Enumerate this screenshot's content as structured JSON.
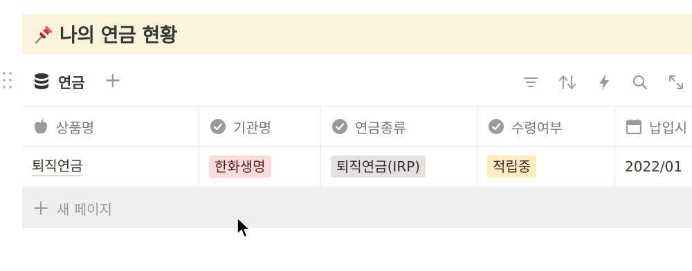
{
  "callout": {
    "emoji": "pushpin-icon",
    "title": "나의 연금 현황",
    "bg": "#fbf3db"
  },
  "database": {
    "title": "연금",
    "add_label": "+",
    "toolbar": [
      "filter-icon",
      "sort-icon",
      "automation-icon",
      "search-icon",
      "expand-icon"
    ]
  },
  "table": {
    "columns": [
      {
        "label": "상품명",
        "icon": "apple-icon"
      },
      {
        "label": "기관명",
        "icon": "check-circle-icon"
      },
      {
        "label": "연금종류",
        "icon": "check-circle-icon"
      },
      {
        "label": "수령여부",
        "icon": "check-circle-icon"
      },
      {
        "label": "납입시",
        "icon": "calendar-icon"
      }
    ],
    "rows": [
      {
        "product": "퇴직연금",
        "institution": {
          "text": "한화생명",
          "color": "#fbdcd8"
        },
        "pension_type": {
          "text": "퇴직연금(IRP)",
          "color": "#e3e2e0"
        },
        "status": {
          "text": "적립중",
          "color": "#fbecc2"
        },
        "start_date": "2022/01"
      }
    ],
    "new_page_label": "새 페이지"
  }
}
